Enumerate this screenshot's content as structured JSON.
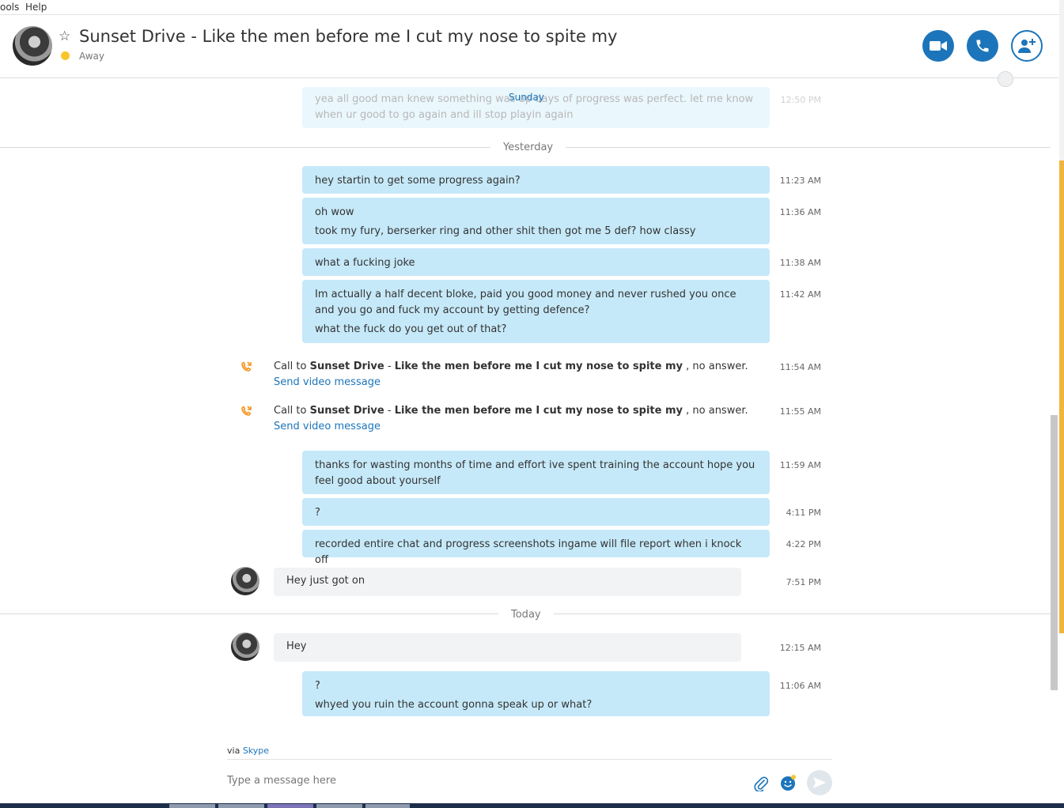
{
  "menu": {
    "items": [
      "ools",
      "Help"
    ]
  },
  "header": {
    "title": "Sunset Drive - Like the men before me I cut my nose to spite my",
    "status": "Away"
  },
  "separators": {
    "sunday": "Sunday",
    "yesterday": "Yesterday",
    "today": "Today"
  },
  "faded_bubble": {
    "line1": "yea all good man knew something was up   days of progress was perfect. let me know",
    "line2": "when ur good to go again and ill stop playin again",
    "time": "12:50 PM"
  },
  "messages": [
    {
      "lines": [
        "hey startin to get some progress again?"
      ],
      "time": "11:23 AM"
    },
    {
      "lines": [
        "oh wow",
        "took my fury, berserker ring and other shit then got me 5 def? how classy"
      ],
      "time": "11:36 AM"
    },
    {
      "lines": [
        "what  a fucking joke"
      ],
      "time": "11:38 AM"
    },
    {
      "lines": [
        "Im actually a half decent bloke, paid you good money and never rushed you once and you go and fuck my account by getting defence?",
        "what the fuck do you get out of that?"
      ],
      "time": "11:42 AM"
    },
    {
      "lines": [
        "thanks for wasting months of time and effort ive spent training the account hope you feel good about yourself"
      ],
      "time": "11:59 AM"
    },
    {
      "lines": [
        "?"
      ],
      "time": "4:11 PM"
    },
    {
      "lines": [
        "recorded entire chat and progress screenshots ingame will file report when i knock off"
      ],
      "time": "4:22 PM"
    },
    {
      "lines": [
        "?",
        "whyed you ruin the account gonna speak up or what?"
      ],
      "time": "11:06 AM"
    }
  ],
  "calls": [
    {
      "prefix": "Call to ",
      "name": "Sunset Drive",
      "dash": " - ",
      "bold_rest": "Like the men before me I cut my nose to spite my",
      "suffix": " , no answer.",
      "link": "Send video message",
      "time": "11:54 AM"
    },
    {
      "prefix": "Call to ",
      "name": "Sunset Drive",
      "dash": " - ",
      "bold_rest": "Like the men before me I cut my nose to spite my",
      "suffix": " , no answer.",
      "link": "Send video message",
      "time": "11:55 AM"
    }
  ],
  "incoming": [
    {
      "text": "Hey just got on",
      "time": "7:51 PM"
    },
    {
      "text": "Hey",
      "time": "12:15 AM"
    }
  ],
  "footer": {
    "via_prefix": "via ",
    "via_link": "Skype",
    "placeholder": "Type a message here"
  },
  "colors": {
    "accent": "#1c75ba",
    "bubble_mine": "#c6e9f9",
    "bubble_theirs": "#f1f3f5",
    "away": "#f8c52a",
    "call_icon": "#f7941d"
  },
  "icons": [
    "star-icon",
    "video-call-icon",
    "audio-call-icon",
    "add-person-icon",
    "globe-icon",
    "missed-call-icon",
    "paperclip-icon",
    "emoticon-icon",
    "send-icon"
  ]
}
